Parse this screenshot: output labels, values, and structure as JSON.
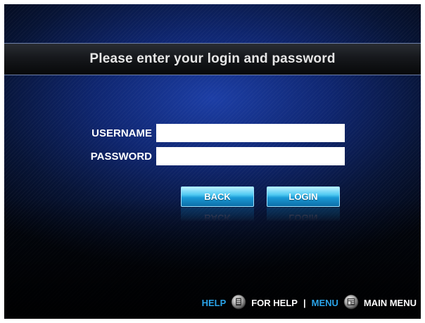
{
  "header": {
    "title": "Please enter your login and password"
  },
  "form": {
    "username_label": "USERNAME",
    "username_value": "",
    "password_label": "PASSWORD",
    "password_value": ""
  },
  "buttons": {
    "back_label": "BACK",
    "login_label": "LOGIN"
  },
  "footer": {
    "help_key": "HELP",
    "help_icon": "remote-help-button-icon",
    "help_text": "FOR HELP",
    "separator": "|",
    "menu_key": "MENU",
    "menu_icon": "remote-menu-button-icon",
    "menu_text": "MAIN MENU"
  },
  "colors": {
    "accent_blue": "#2aa3e8",
    "button_blue": "#4fc9f2",
    "background_navy": "#0f2670"
  }
}
